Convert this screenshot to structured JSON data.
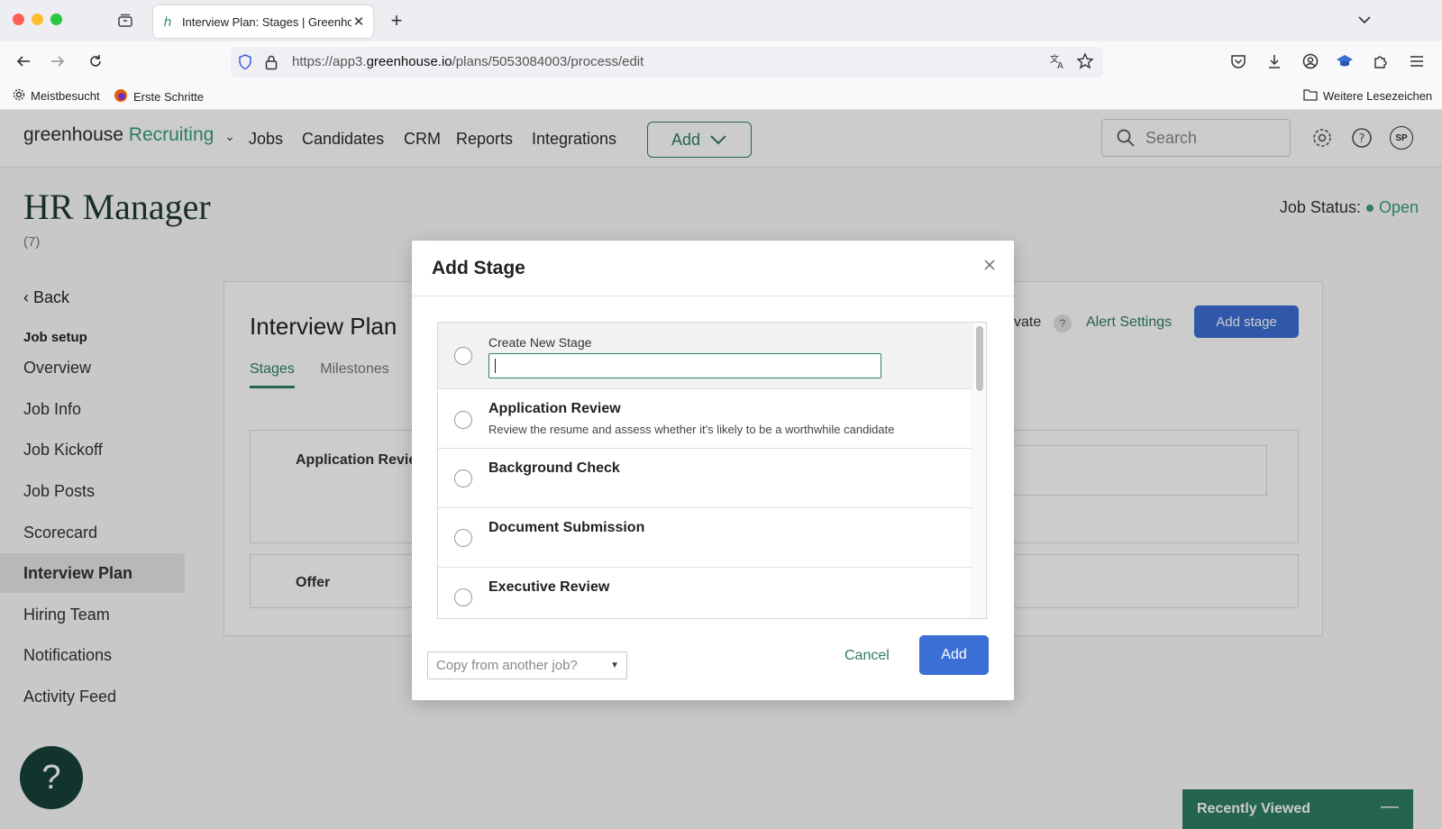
{
  "browser": {
    "tab_title": "Interview Plan: Stages | Greenhouse",
    "url_prefix": "https://app3.",
    "url_domain": "greenhouse.io",
    "url_path": "/plans/5053084003/process/edit",
    "bookmarks": [
      "Meistbesucht",
      "Erste Schritte"
    ],
    "other_bookmarks": "Weitere Lesezeichen"
  },
  "app": {
    "logo_main": "greenhouse",
    "logo_sub": "Recruiting",
    "nav": [
      "Jobs",
      "Candidates",
      "CRM",
      "Reports",
      "Integrations"
    ],
    "add_label": "Add",
    "search_placeholder": "Search",
    "avatar_initials": "SP"
  },
  "job": {
    "title": "HR Manager",
    "count": "(7)",
    "status_label": "Job Status:",
    "status_value": "Open"
  },
  "sidebar": {
    "back": "Back",
    "section": "Job setup",
    "items": [
      "Overview",
      "Job Info",
      "Job Kickoff",
      "Job Posts",
      "Scorecard",
      "Interview Plan",
      "Hiring Team",
      "Notifications",
      "Activity Feed"
    ],
    "active_index": 5
  },
  "panel": {
    "title": "Interview Plan",
    "tabs": [
      "Stages",
      "Milestones"
    ],
    "private_fragment": "vate",
    "alert_settings": "Alert Settings",
    "add_stage": "Add stage",
    "stages": [
      "Application Revie",
      "Offer"
    ]
  },
  "modal": {
    "title": "Add Stage",
    "create_new_label": "Create New Stage",
    "create_new_value": "",
    "options": [
      {
        "name": "Application Review",
        "description": "Review the resume and assess whether it's likely to be a worthwhile candidate"
      },
      {
        "name": "Background Check",
        "description": ""
      },
      {
        "name": "Document Submission",
        "description": ""
      },
      {
        "name": "Executive Review",
        "description": ""
      }
    ],
    "copy_placeholder": "Copy from another job?",
    "cancel": "Cancel",
    "add": "Add"
  },
  "widgets": {
    "help_glyph": "?",
    "recently_viewed": "Recently Viewed"
  }
}
